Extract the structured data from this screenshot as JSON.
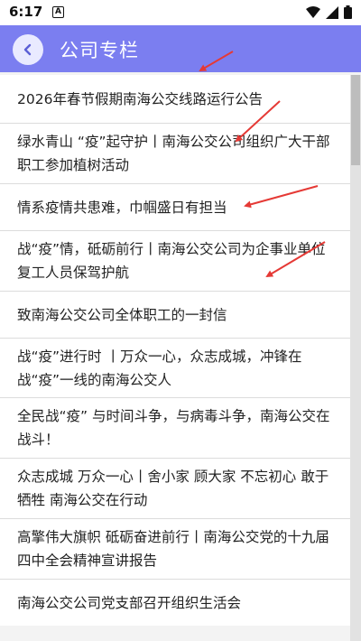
{
  "status_bar": {
    "time": "6:17",
    "badge": "A",
    "icons": [
      "wifi-icon",
      "signal-icon",
      "battery-icon"
    ]
  },
  "app_bar": {
    "title": "公司专栏",
    "back_icon": "chevron-left-icon",
    "color": "#7b7ef0"
  },
  "news": [
    {
      "title": "2026年春节假期南海公交线路运行公告"
    },
    {
      "title": "绿水青山 “疫”起守护丨南海公交公司组织广大干部职工参加植树活动"
    },
    {
      "title": "情系疫情共患难，巾帼盛日有担当"
    },
    {
      "title": "战“疫”情，砥砺前行丨南海公交公司为企事业单位复工人员保驾护航"
    },
    {
      "title": "致南海公交公司全体职工的一封信"
    },
    {
      "title": "战“疫”进行时 丨万众一心，众志成城，冲锋在战“疫”一线的南海公交人"
    },
    {
      "title": "全民战“疫” 与时间斗争，与病毒斗争，南海公交在战斗！"
    },
    {
      "title": "众志成城 万众一心丨舍小家 顾大家 不忘初心 敢于牺牲 南海公交在行动"
    },
    {
      "title": "高擎伟大旗帜 砥砺奋进前行丨南海公交党的十九届四中全会精神宣讲报告"
    },
    {
      "title": "南海公交公司党支部召开组织生活会"
    }
  ],
  "annotation_color": "#e53935"
}
